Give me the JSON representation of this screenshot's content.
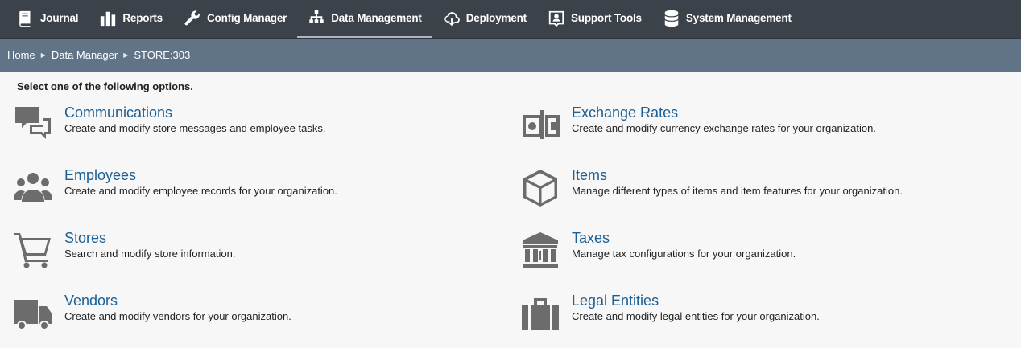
{
  "nav": {
    "items": [
      {
        "label": "Journal",
        "icon": "journal-icon"
      },
      {
        "label": "Reports",
        "icon": "bar-chart-icon"
      },
      {
        "label": "Config Manager",
        "icon": "wrench-icon"
      },
      {
        "label": "Data Management",
        "icon": "hierarchy-icon"
      },
      {
        "label": "Deployment",
        "icon": "cloud-download-icon"
      },
      {
        "label": "Support Tools",
        "icon": "support-icon"
      },
      {
        "label": "System Management",
        "icon": "database-icon"
      }
    ],
    "active_index": 3,
    "background": "#3c4249"
  },
  "breadcrumb": {
    "items": [
      "Home",
      "Data Manager",
      "STORE:303"
    ],
    "background": "#607387"
  },
  "main": {
    "instruction": "Select one of the following options.",
    "options": [
      {
        "title": "Communications",
        "description": "Create and modify store messages and employee tasks.",
        "icon": "chat-bubbles-icon"
      },
      {
        "title": "Exchange Rates",
        "description": "Create and modify currency exchange rates for your organization.",
        "icon": "currency-exchange-icon"
      },
      {
        "title": "Employees",
        "description": "Create and modify employee records for your organization.",
        "icon": "people-group-icon"
      },
      {
        "title": "Items",
        "description": "Manage different types of items and item features for your organization.",
        "icon": "cube-icon"
      },
      {
        "title": "Stores",
        "description": "Search and modify store information.",
        "icon": "shopping-cart-icon"
      },
      {
        "title": "Taxes",
        "description": "Manage tax configurations for your organization.",
        "icon": "bank-building-icon"
      },
      {
        "title": "Vendors",
        "description": "Create and modify vendors for your organization.",
        "icon": "truck-icon"
      },
      {
        "title": "Legal Entities",
        "description": "Create and modify legal entities for your organization.",
        "icon": "briefcase-icon"
      }
    ],
    "link_color": "#1c5f94"
  }
}
